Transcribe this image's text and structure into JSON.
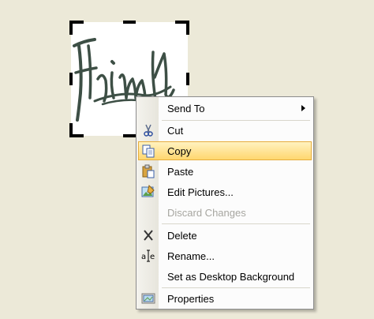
{
  "image": {
    "icon": "signature-image"
  },
  "menu": {
    "items": [
      {
        "label": "Send To",
        "icon": "send-to",
        "has_submenu": true
      },
      {
        "label": "Cut",
        "icon": "scissors-icon"
      },
      {
        "label": "Copy",
        "icon": "copy-icon",
        "highlighted": true
      },
      {
        "label": "Paste",
        "icon": "paste-icon"
      },
      {
        "label": "Edit Pictures...",
        "icon": "edit-pictures-icon"
      },
      {
        "label": "Discard Changes",
        "icon": "",
        "disabled": true
      },
      {
        "label": "Delete",
        "icon": "delete-x-icon"
      },
      {
        "label": "Rename...",
        "icon": "rename-icon"
      },
      {
        "label": "Set as Desktop Background",
        "icon": ""
      },
      {
        "label": "Properties",
        "icon": "properties-icon"
      }
    ]
  },
  "colors": {
    "background": "#ece9d8",
    "highlight_top": "#fff2c0",
    "highlight_bottom": "#ffd76f",
    "highlight_border": "#e6ad3c",
    "disabled_text": "#a7a6a0"
  }
}
